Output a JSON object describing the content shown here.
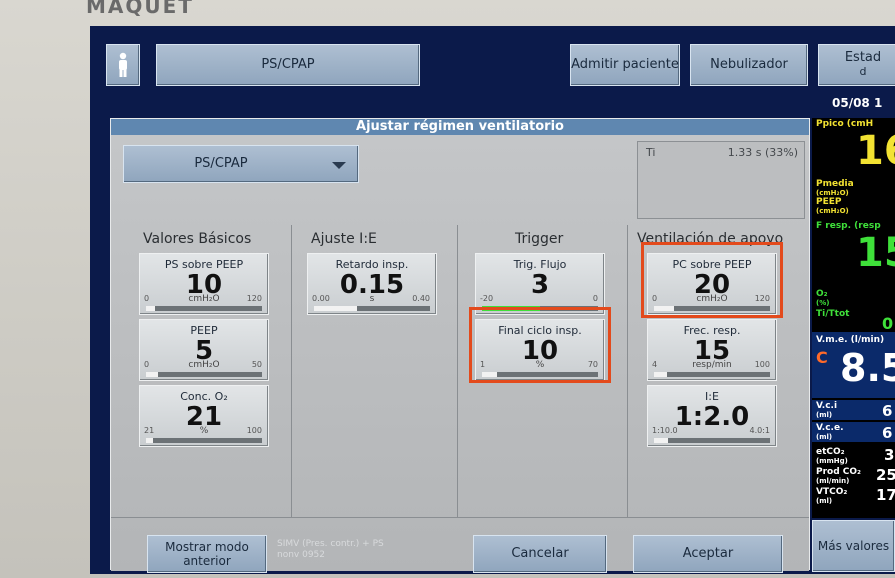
{
  "brand": "MAQUET",
  "topbar": {
    "mode_label": "PS/CPAP",
    "admit_label": "Admitir paciente",
    "nebulizer_label": "Nebulizador",
    "status_label": "Estad",
    "status_sub": "d",
    "date": "05/08 1"
  },
  "dialog": {
    "title": "Ajustar régimen ventilatorio",
    "mode_select": "PS/CPAP",
    "ti": {
      "label": "Ti",
      "value": "1.33 s (33%)"
    },
    "columns": {
      "basic": "Valores Básicos",
      "ie": "Ajuste I:E",
      "trigger": "Trigger",
      "support": "Ventilación de apoyo"
    },
    "tiles": {
      "ps_peep": {
        "label": "PS sobre PEEP",
        "value": "10",
        "unit": "cmH₂O",
        "min": "0",
        "max": "120",
        "level": 0.08
      },
      "peep": {
        "label": "PEEP",
        "value": "5",
        "unit": "cmH₂O",
        "min": "0",
        "max": "50",
        "level": 0.1
      },
      "o2": {
        "label": "Conc. O₂",
        "value": "21",
        "unit": "%",
        "min": "21",
        "max": "100",
        "level": 0.0
      },
      "insp_delay": {
        "label": "Retardo insp.",
        "value": "0.15",
        "unit": "s",
        "min": "0.00",
        "max": "0.40",
        "level": 0.37
      },
      "trig_flow": {
        "label": "Trig. Flujo",
        "value": "3",
        "unit": "",
        "min": "-20",
        "max": "0",
        "level": 0.0
      },
      "end_cycle": {
        "label": "Final ciclo insp.",
        "value": "10",
        "unit": "%",
        "min": "1",
        "max": "70",
        "level": 0.13
      },
      "pc_peep": {
        "label": "PC sobre PEEP",
        "value": "20",
        "unit": "cmH₂O",
        "min": "0",
        "max": "120",
        "level": 0.17
      },
      "freq": {
        "label": "Frec. resp.",
        "value": "15",
        "unit": "resp/min",
        "min": "4",
        "max": "100",
        "level": 0.11
      },
      "ie": {
        "label": "I:E",
        "value": "1:2.0",
        "unit": "",
        "min": "1:10.0",
        "max": "4.0:1",
        "level": 0.12
      }
    },
    "buttons": {
      "show_previous": "Mostrar modo anterior",
      "cancel": "Cancelar",
      "accept": "Aceptar"
    },
    "footnote_1": "SIMV (Pres. contr.) + PS",
    "footnote_2": "nonv 0952"
  },
  "side_panel": {
    "ppico_label": "Ppico (cmH",
    "ppico_value": "16",
    "pmedia_label": "Pmedia",
    "pmedia_unit": "(cmH₂O)",
    "peep_label": "PEEP",
    "peep_unit": "(cmH₂O)",
    "fresp_label": "F resp. (resp",
    "fresp_value": "15",
    "o2_label": "O₂",
    "o2_unit": "(%)",
    "titot_label": "Ti/Ttot",
    "titot_value": "0",
    "vme_label": "V.m.e. (l/min)",
    "vme_flag": "C",
    "vme_value": "8.5",
    "vci_label": "V.c.i",
    "vci_unit": "(ml)",
    "vci_value": "6",
    "vce_label": "V.c.e.",
    "vce_unit": "(ml)",
    "vce_value": "6",
    "etco2_label": "etCO₂",
    "etco2_unit": "(mmHg)",
    "etco2_value": "3",
    "prodco2_label": "Prod CO₂",
    "prodco2_unit": "(ml/min)",
    "prodco2_value": "25",
    "vtco2_label": "VTCO₂",
    "vtco2_unit": "(ml)",
    "vtco2_value": "17",
    "more_values": "Más valores"
  },
  "colors": {
    "highlight": "#e34a1c",
    "yellow": "#f2e232",
    "green": "#3fe03a",
    "cyan": "#3cd6e6"
  }
}
